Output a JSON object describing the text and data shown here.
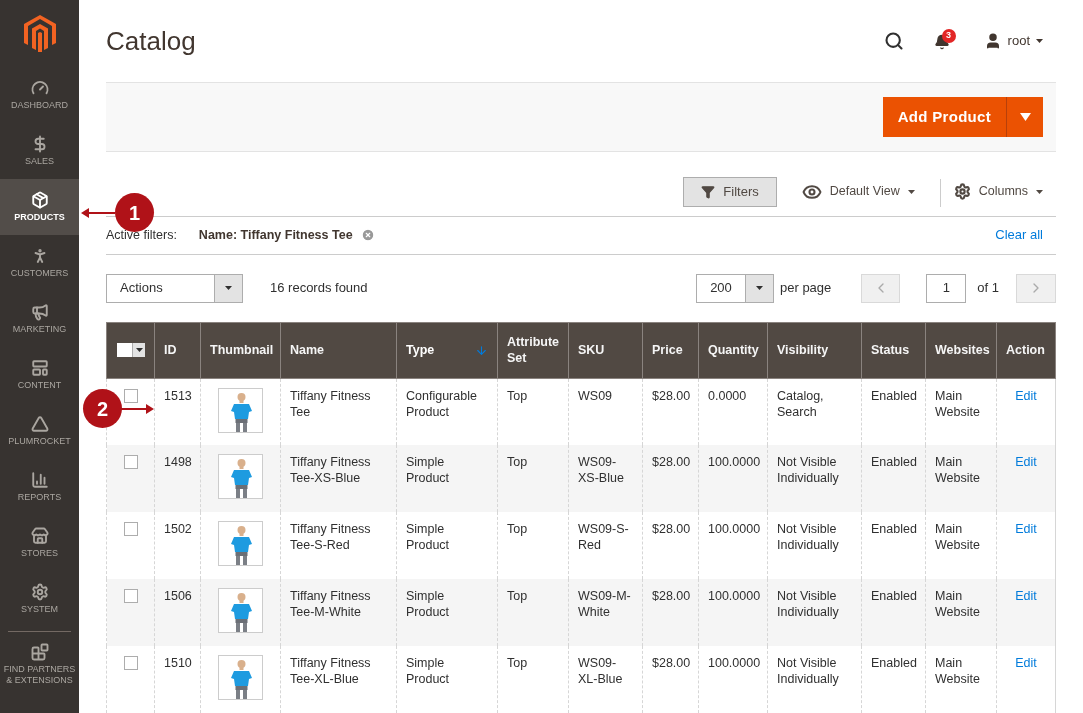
{
  "sidebar": {
    "items": [
      {
        "label": "DASHBOARD",
        "selected": false
      },
      {
        "label": "SALES",
        "selected": false
      },
      {
        "label": "PRODUCTS",
        "selected": true
      },
      {
        "label": "CUSTOMERS",
        "selected": false
      },
      {
        "label": "MARKETING",
        "selected": false
      },
      {
        "label": "CONTENT",
        "selected": false
      },
      {
        "label": "PLUMROCKET",
        "selected": false
      },
      {
        "label": "REPORTS",
        "selected": false
      },
      {
        "label": "STORES",
        "selected": false
      },
      {
        "label": "SYSTEM",
        "selected": false
      },
      {
        "label": "FIND PARTNERS & EXTENSIONS",
        "selected": false
      }
    ]
  },
  "header": {
    "title": "Catalog",
    "notifications": "3",
    "user": "root"
  },
  "add_button": {
    "label": "Add Product"
  },
  "toolbar": {
    "filters": "Filters",
    "view": "Default View",
    "columns": "Columns"
  },
  "active_filters": {
    "label": "Active filters:",
    "filters": [
      "Name: Tiffany Fitness Tee"
    ],
    "clear": "Clear all"
  },
  "grid_controls": {
    "actions": "Actions",
    "records": "16 records found",
    "per_page_value": "200",
    "per_page_label": "per page",
    "page": "1",
    "page_total": "of 1"
  },
  "table": {
    "columns": [
      {
        "label": "ID",
        "sorted": false
      },
      {
        "label": "Thumbnail",
        "sorted": false
      },
      {
        "label": "Name",
        "sorted": false
      },
      {
        "label": "Type",
        "sorted": true
      },
      {
        "label": "Attribute Set",
        "sorted": false
      },
      {
        "label": "SKU",
        "sorted": false
      },
      {
        "label": "Price",
        "sorted": false
      },
      {
        "label": "Quantity",
        "sorted": false
      },
      {
        "label": "Visibility",
        "sorted": false
      },
      {
        "label": "Status",
        "sorted": false
      },
      {
        "label": "Websites",
        "sorted": false
      },
      {
        "label": "Action",
        "sorted": false
      }
    ],
    "rows": [
      {
        "checked": false,
        "cells": [
          "1513",
          {
            "kind": "picture"
          },
          "Tiffany Fitness Tee",
          "Configurable Product",
          "Top",
          "WS09",
          "$28.00",
          "0.0000",
          "Catalog, Search",
          "Enabled",
          "Main Website",
          {
            "kind": "link",
            "text": "Edit"
          }
        ]
      },
      {
        "checked": false,
        "cells": [
          "1498",
          {
            "kind": "picture"
          },
          "Tiffany Fitness Tee-XS-Blue",
          "Simple Product",
          "Top",
          "WS09-XS-Blue",
          "$28.00",
          "100.0000",
          "Not Visible Individually",
          "Enabled",
          "Main Website",
          {
            "kind": "link",
            "text": "Edit"
          }
        ]
      },
      {
        "checked": false,
        "cells": [
          "1502",
          {
            "kind": "picture"
          },
          "Tiffany Fitness Tee-S-Red",
          "Simple Product",
          "Top",
          "WS09-S-Red",
          "$28.00",
          "100.0000",
          "Not Visible Individually",
          "Enabled",
          "Main Website",
          {
            "kind": "link",
            "text": "Edit"
          }
        ]
      },
      {
        "checked": false,
        "cells": [
          "1506",
          {
            "kind": "picture"
          },
          "Tiffany Fitness Tee-M-White",
          "Simple Product",
          "Top",
          "WS09-M-White",
          "$28.00",
          "100.0000",
          "Not Visible Individually",
          "Enabled",
          "Main Website",
          {
            "kind": "link",
            "text": "Edit"
          }
        ]
      },
      {
        "checked": false,
        "cells": [
          "1510",
          {
            "kind": "picture"
          },
          "Tiffany Fitness Tee-XL-Blue",
          "Simple Product",
          "Top",
          "WS09-XL-Blue",
          "$28.00",
          "100.0000",
          "Not Visible Individually",
          "Enabled",
          "Main Website",
          {
            "kind": "link",
            "text": "Edit"
          }
        ]
      }
    ]
  },
  "callouts": [
    {
      "label": "1"
    },
    {
      "label": "2"
    }
  ]
}
